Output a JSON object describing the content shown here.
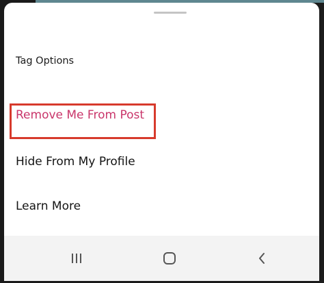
{
  "sheet": {
    "title": "Tag Options",
    "options": [
      {
        "label": "Remove Me From Post",
        "color": "#c9356a",
        "highlighted": true
      },
      {
        "label": "Hide From My Profile"
      },
      {
        "label": "Learn More"
      }
    ],
    "highlight_color": "#d73a2c"
  },
  "navbar": {
    "buttons": [
      {
        "icon": "recent-apps-icon"
      },
      {
        "icon": "home-icon"
      },
      {
        "icon": "back-icon"
      }
    ]
  }
}
